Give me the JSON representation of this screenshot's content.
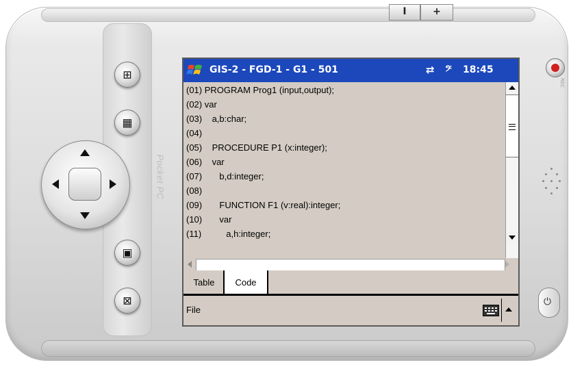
{
  "device": {
    "volume_down_label": "I",
    "volume_up_label": "+",
    "brand_text": "Pocket PC",
    "rec_label": "REC"
  },
  "titlebar": {
    "title": "GIS-2 - FGD-1 - G1 - 501",
    "connectivity_icon": "⇄",
    "volume_icon": "🔊",
    "clock": "18:45",
    "accent": "#1c48bc"
  },
  "code": {
    "lines": [
      "(01) PROGRAM Prog1 (input,output);",
      "(02) var",
      "(03)    a,b:char;",
      "(04)",
      "(05)    PROCEDURE P1 (x:integer);",
      "(06)    var",
      "(07)       b,d:integer;",
      "(08)",
      "(09)       FUNCTION F1 (v:real):integer;",
      "(10)       var",
      "(11)          a,h:integer;"
    ]
  },
  "tabs": [
    {
      "label": "Table"
    },
    {
      "label": "Code"
    }
  ],
  "active_tab": "Code",
  "menubar": {
    "file_label": "File"
  },
  "colors": {
    "screen_bg": "#d4ccc4",
    "titlebar_bg": "#1c48bc"
  }
}
